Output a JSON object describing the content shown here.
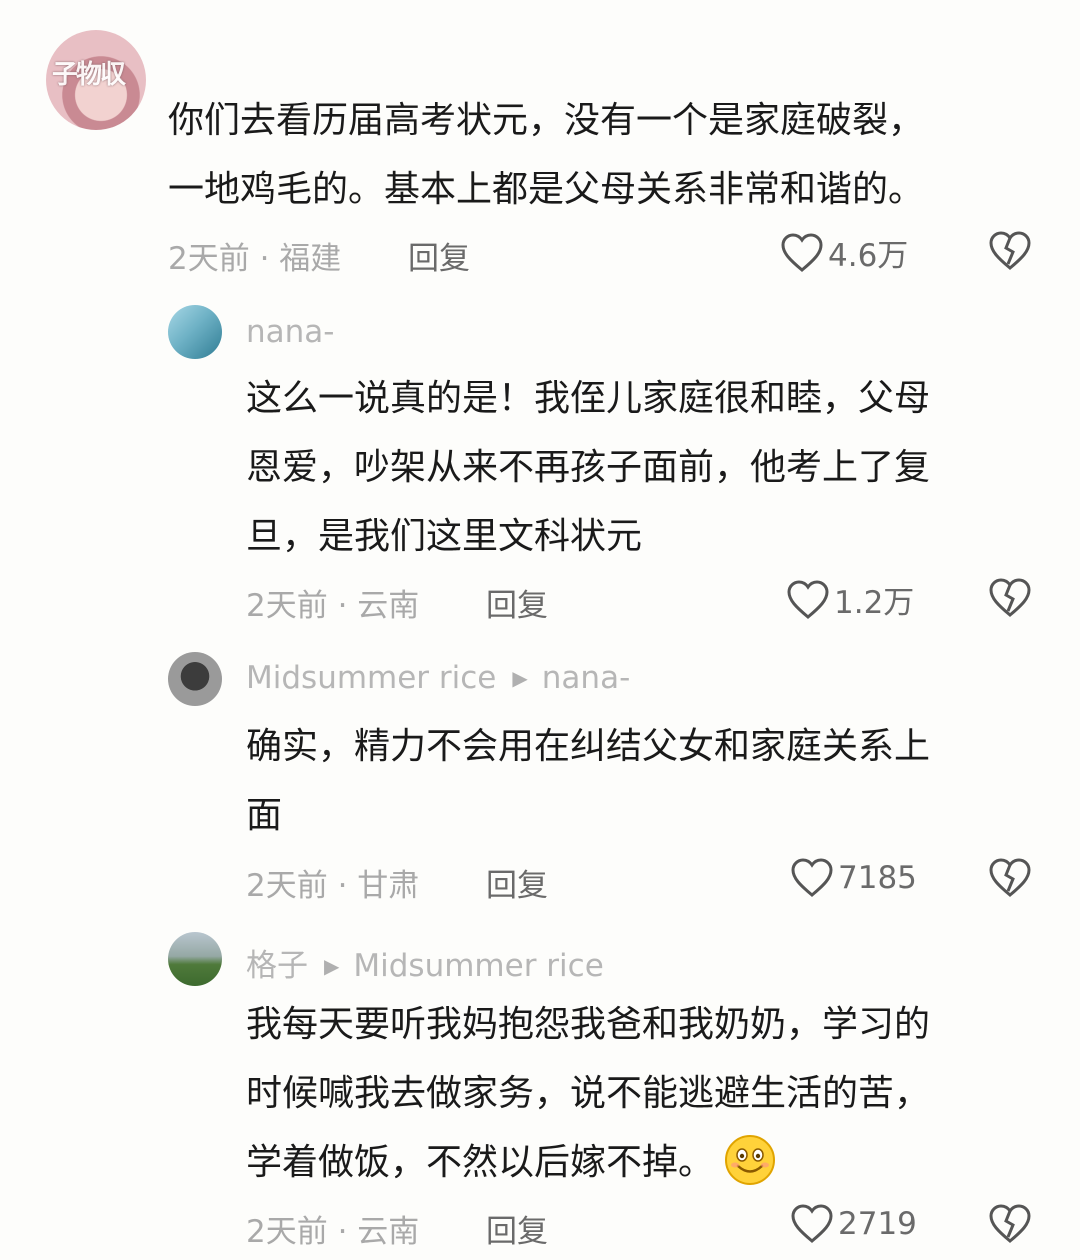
{
  "comments": [
    {
      "avatar_watermark": "子物収",
      "username": "",
      "lines": [
        "你们去看历届高考状元，没有一个是家庭破裂，",
        "一地鸡毛的。基本上都是父母关系非常和谐的。"
      ],
      "meta": "2天前 · 福建",
      "reply_label": "回复",
      "likes": "4.6万"
    },
    {
      "username": "nana-",
      "lines": [
        "这么一说真的是！我侄儿家庭很和睦，父母",
        "恩爱，吵架从来不再孩子面前，他考上了复",
        "旦，是我们这里文科状元"
      ],
      "meta": "2天前 · 云南",
      "reply_label": "回复",
      "likes": "1.2万"
    },
    {
      "username": "Midsummer rice",
      "reply_to": "nana-",
      "lines": [
        "确实，精力不会用在纠结父女和家庭关系上",
        "面"
      ],
      "meta": "2天前 · 甘肃",
      "reply_label": "回复",
      "likes": "7185"
    },
    {
      "username": "格子",
      "reply_to": "Midsummer rice",
      "lines": [
        "我每天要听我妈抱怨我爸和我奶奶，学习的",
        "时候喊我去做家务，说不能逃避生活的苦，",
        "学着做饭，不然以后嫁不掉。"
      ],
      "meta": "2天前 · 云南",
      "reply_label": "回复",
      "likes": "2719"
    }
  ]
}
